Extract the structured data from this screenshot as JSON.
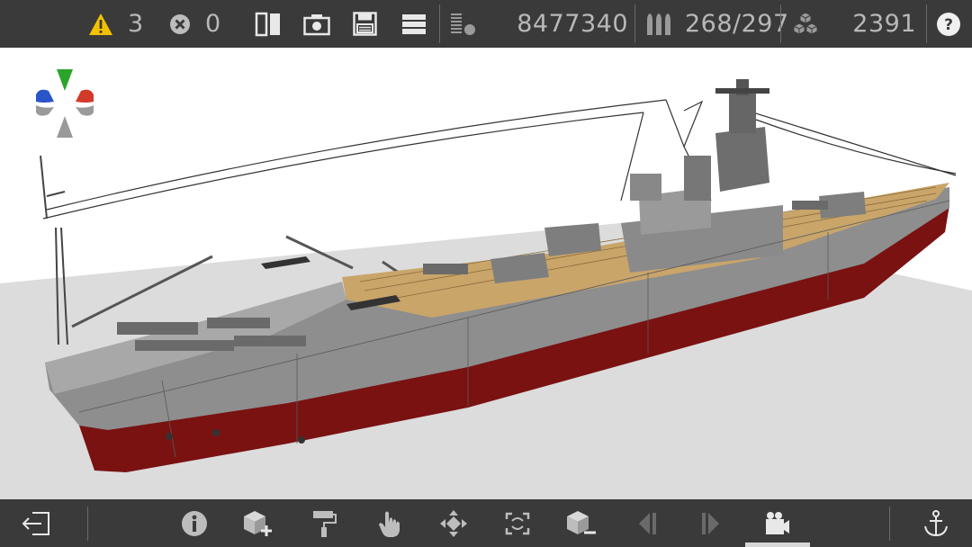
{
  "toolbar_top": {
    "warnings_count": "3",
    "errors_count": "0",
    "polygon_count": "8477340",
    "ammo_count": "268/297",
    "parts_count": "2391",
    "icons": {
      "warning": "warning-icon",
      "error": "error-icon",
      "compare": "split-view-icon",
      "screenshot": "camera-icon",
      "save": "save-icon",
      "menu": "menu-icon",
      "polycount": "polycount-icon",
      "ammo": "ammo-icon",
      "parts": "cubes-icon",
      "help": "help-icon"
    },
    "colors": {
      "warning": "#f2c200",
      "bar_bg": "#3a3a3a",
      "text": "#b8b8b8"
    }
  },
  "toolbar_bottom": {
    "icons": [
      "exit-icon",
      "info-icon",
      "add-block-icon",
      "paint-roller-icon",
      "touch-icon",
      "move-icon",
      "rotate-icon",
      "remove-block-icon",
      "previous-icon",
      "next-icon",
      "camera-mode-icon",
      "anchor-icon"
    ],
    "active": "camera-mode-icon"
  },
  "viewport": {
    "subject": "battleship",
    "colors": {
      "hull_upper": "#8e8e8e",
      "hull_lower": "#7a1212",
      "deck": "#c9a56a",
      "ground": "#dcdcdc"
    }
  },
  "axis_gizmo": {
    "colors": {
      "x": "#d23a2a",
      "y": "#2aa52a",
      "z": "#2a55c8",
      "neutral": "#9a9a9a"
    }
  }
}
